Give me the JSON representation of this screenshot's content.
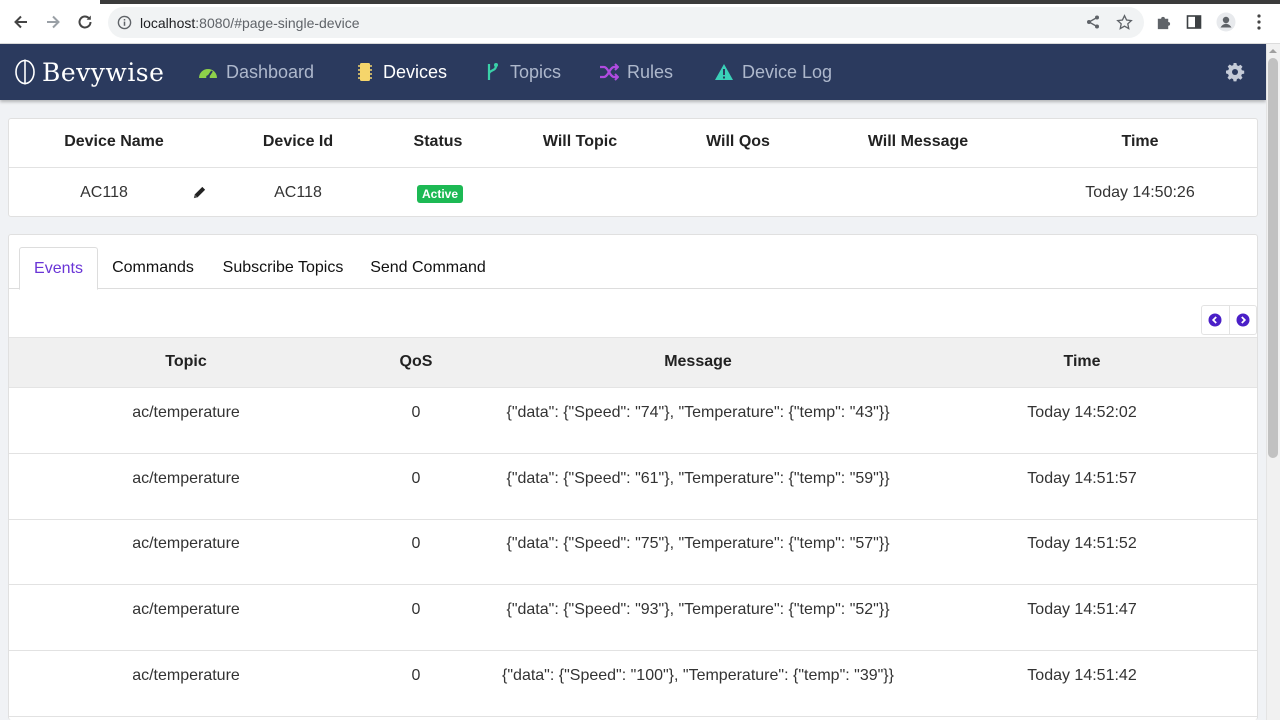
{
  "browser": {
    "url_host": "localhost",
    "url_rest": ":8080/#page-single-device"
  },
  "nav": {
    "logo": "Bevywise",
    "items": [
      {
        "label": "Dashboard",
        "icon": "gauge-icon",
        "color": "#8ed14a"
      },
      {
        "label": "Devices",
        "icon": "chip-icon",
        "color": "#f5d56b"
      },
      {
        "label": "Topics",
        "icon": "branch-icon",
        "color": "#3ad0a8"
      },
      {
        "label": "Rules",
        "icon": "shuffle-icon",
        "color": "#b04be0"
      },
      {
        "label": "Device Log",
        "icon": "warning-icon",
        "color": "#3ad0b8"
      }
    ],
    "active": "Devices"
  },
  "device": {
    "headers": [
      "Device Name",
      "Device Id",
      "Status",
      "Will Topic",
      "Will Qos",
      "Will Message",
      "Time"
    ],
    "name": "AC118",
    "id": "AC118",
    "status": "Active",
    "will_topic": "",
    "will_qos": "",
    "will_message": "",
    "time": "Today 14:50:26"
  },
  "tabs": [
    "Events",
    "Commands",
    "Subscribe Topics",
    "Send Command"
  ],
  "active_tab": "Events",
  "events": {
    "headers": [
      "Topic",
      "QoS",
      "Message",
      "Time"
    ],
    "rows": [
      {
        "topic": "ac/temperature",
        "qos": "0",
        "message": "{\"data\": {\"Speed\": \"74\"}, \"Temperature\": {\"temp\": \"43\"}}",
        "time": "Today 14:52:02"
      },
      {
        "topic": "ac/temperature",
        "qos": "0",
        "message": "{\"data\": {\"Speed\": \"61\"}, \"Temperature\": {\"temp\": \"59\"}}",
        "time": "Today 14:51:57"
      },
      {
        "topic": "ac/temperature",
        "qos": "0",
        "message": "{\"data\": {\"Speed\": \"75\"}, \"Temperature\": {\"temp\": \"57\"}}",
        "time": "Today 14:51:52"
      },
      {
        "topic": "ac/temperature",
        "qos": "0",
        "message": "{\"data\": {\"Speed\": \"93\"}, \"Temperature\": {\"temp\": \"52\"}}",
        "time": "Today 14:51:47"
      },
      {
        "topic": "ac/temperature",
        "qos": "0",
        "message": "{\"data\": {\"Speed\": \"100\"}, \"Temperature\": {\"temp\": \"39\"}}",
        "time": "Today 14:51:42"
      }
    ]
  },
  "colors": {
    "navbar": "#2b3a5e",
    "active_tab": "#6a35d6",
    "status_active": "#1db954",
    "pager_icon": "#4a1fc7"
  }
}
